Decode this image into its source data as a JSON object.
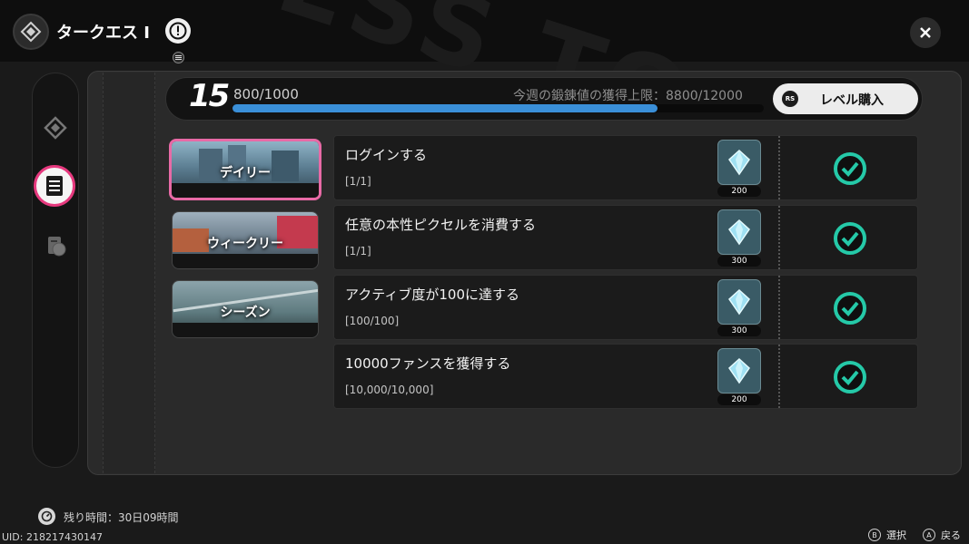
{
  "header": {
    "title": "タークエス Ⅰ",
    "close_icon": "close-icon",
    "alert_icon": "exclamation-icon"
  },
  "level": {
    "current": "15",
    "xp_text": "800/1000",
    "xp_fraction": 0.8,
    "weekly_cap_text": "今週の鍛錬値の獲得上限：8800/12000",
    "buy_icon_text": "RS",
    "buy_label": "レベル購入"
  },
  "categories": [
    {
      "label": "デイリー",
      "active": true
    },
    {
      "label": "ウィークリー",
      "active": false
    },
    {
      "label": "シーズン",
      "active": false
    }
  ],
  "missions": [
    {
      "title": "ログインする",
      "progress": "[1/1]",
      "reward": "200",
      "completed": true
    },
    {
      "title": "任意の本性ピクセルを消費する",
      "progress": "[1/1]",
      "reward": "300",
      "completed": true
    },
    {
      "title": "アクティブ度が100に達する",
      "progress": "[100/100]",
      "reward": "300",
      "completed": true
    },
    {
      "title": "10000ファンスを獲得する",
      "progress": "[10,000/10,000]",
      "reward": "200",
      "completed": true
    }
  ],
  "footer": {
    "remaining": "残り時間：30日09時間",
    "uid": "UID: 218217430147",
    "hint_select_key": "B",
    "hint_select": "選択",
    "hint_back_key": "A",
    "hint_back": "戻る"
  },
  "colors": {
    "accent_pink": "#e86aa6",
    "xp_blue": "#3a8fd8",
    "check_teal": "#25c9a8"
  }
}
